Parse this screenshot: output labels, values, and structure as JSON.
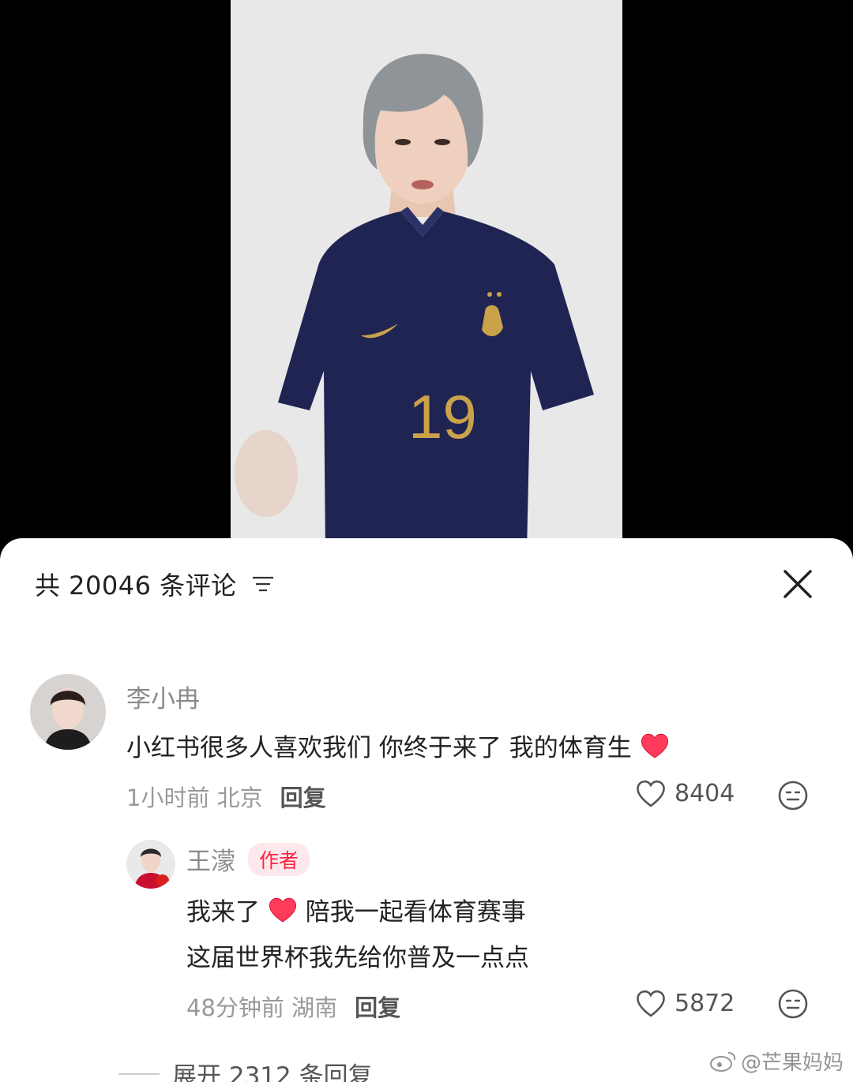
{
  "comments_panel": {
    "title": "共 20046 条评论",
    "close_icon": "close-icon",
    "sort_icon": "sort-lines-icon"
  },
  "video": {
    "jersey_number": "19"
  },
  "comments": [
    {
      "user": "李小冉",
      "text": "小红书很多人喜欢我们 你终于来了 我的体育生",
      "time_location": "1小时前 北京",
      "reply_label": "回复",
      "likes": "8404",
      "emoji_icon": "neutral-face-icon",
      "heart_icon": "red-heart-emoji"
    }
  ],
  "replies": [
    {
      "user": "王濛",
      "badge": "作者",
      "line1_before_heart": "我来了",
      "line1_after_heart": "陪我一起看体育赛事",
      "line2": "这届世界杯我先给你普及一点点",
      "time_location": "48分钟前 湖南",
      "reply_label": "回复",
      "likes": "5872",
      "emoji_icon": "neutral-face-icon"
    }
  ],
  "expand": {
    "label": "展开 2312 条回复"
  },
  "watermark": {
    "text": "@芒果妈妈",
    "icon": "weibo-icon"
  },
  "colors": {
    "accent": "#ff2442",
    "badge_bg": "#fde9ec",
    "jersey": "#1f2452",
    "gold": "#c9a24a"
  }
}
